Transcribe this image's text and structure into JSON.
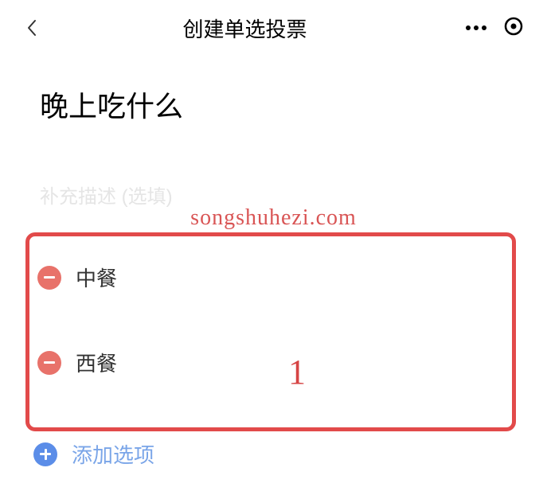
{
  "header": {
    "title": "创建单选投票"
  },
  "poll": {
    "title": "晚上吃什么",
    "description_placeholder": "补充描述 (选填)"
  },
  "options": [
    {
      "label": "中餐"
    },
    {
      "label": "西餐"
    }
  ],
  "actions": {
    "add_option_label": "添加选项"
  },
  "watermark": {
    "text": "songshuhezi.com"
  },
  "annotation": {
    "number": "1"
  }
}
